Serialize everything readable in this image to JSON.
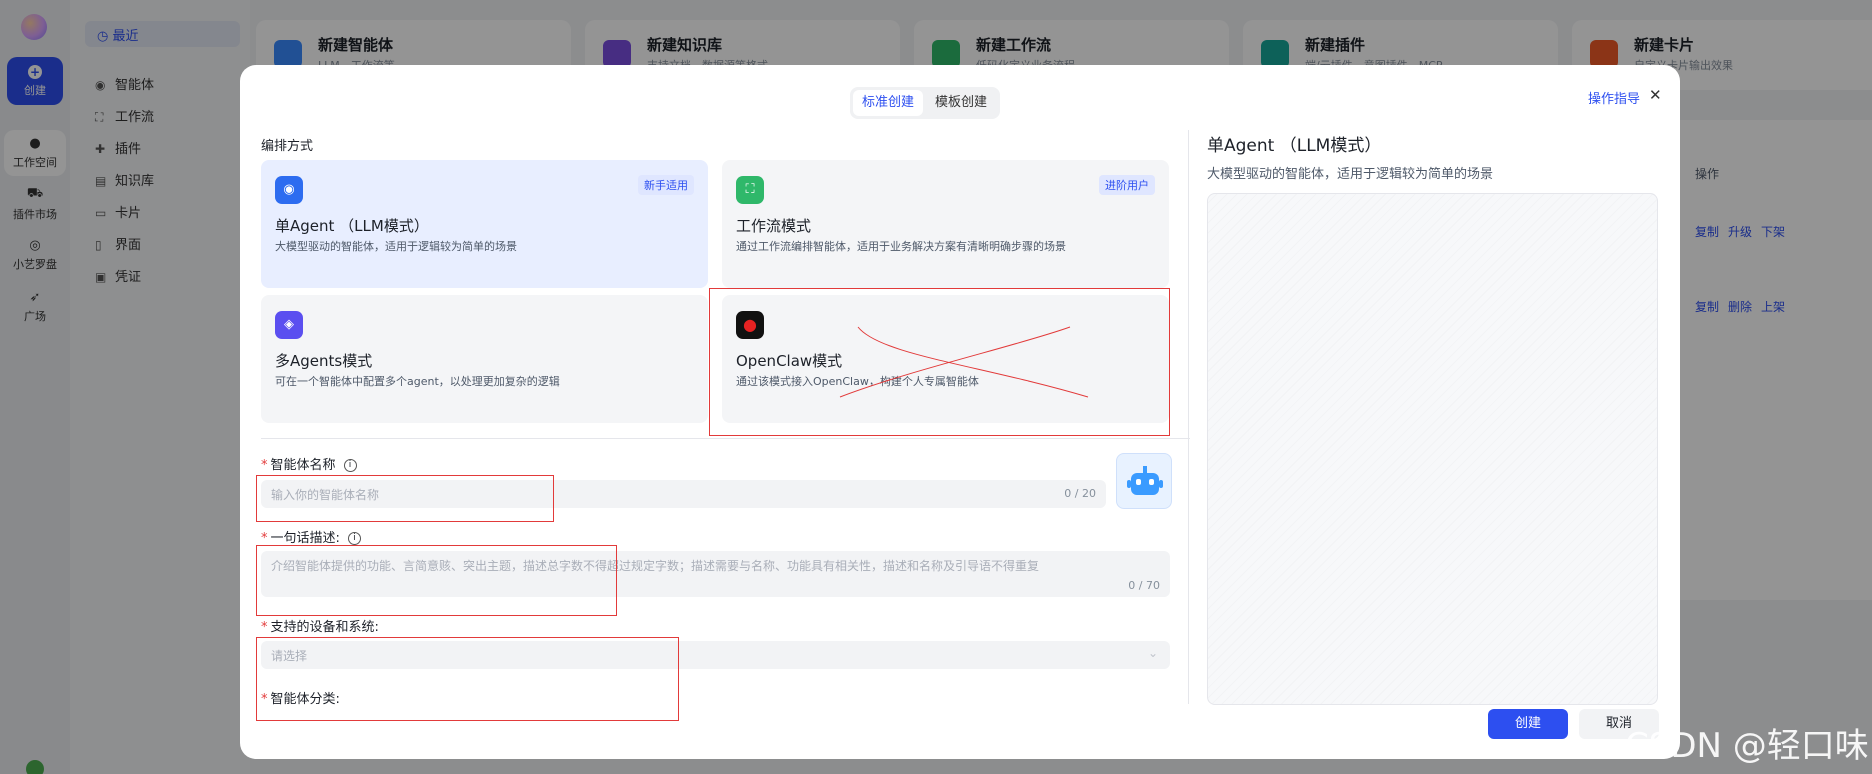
{
  "rail": {
    "create": "创建",
    "items": [
      "工作空间",
      "插件市场",
      "小艺罗盘",
      "广场"
    ]
  },
  "nav": {
    "active": "最近",
    "items": [
      "智能体",
      "工作流",
      "插件",
      "知识库",
      "卡片",
      "界面",
      "凭证"
    ]
  },
  "top_cards": [
    {
      "title": "新建智能体",
      "sub": "LLM、工作流等",
      "color": "#3a8bff"
    },
    {
      "title": "新建知识库",
      "sub": "支持文档、数据源等格式",
      "color": "#7a4fe0"
    },
    {
      "title": "新建工作流",
      "sub": "低码化定义业务流程",
      "color": "#2fb86a"
    },
    {
      "title": "新建插件",
      "sub": "端/云插件、意图插件、MCP",
      "color": "#17a89a"
    },
    {
      "title": "新建卡片",
      "sub": "自定义卡片输出效果",
      "color": "#f05a28"
    }
  ],
  "bg_table": {
    "op_header": "操作",
    "row1": [
      "复制",
      "升级",
      "下架"
    ],
    "row2": [
      "复制",
      "删除",
      "上架"
    ]
  },
  "modal": {
    "tabs": [
      "标准创建",
      "模板创建"
    ],
    "guide": "操作指导",
    "close": "✕",
    "section_title": "编排方式",
    "modes": [
      {
        "title": "单Agent （LLM模式）",
        "desc": "大模型驱动的智能体，适用于逻辑较为简单的场景",
        "tag": "新手适用",
        "color": "#2d6cf0",
        "icon": "robot-icon",
        "selected": true
      },
      {
        "title": "工作流模式",
        "desc": "通过工作流编排智能体，适用于业务解决方案有清晰明确步骤的场景",
        "tag": "进阶用户",
        "color": "#2fb86a",
        "icon": "workflow-icon",
        "selected": false
      },
      {
        "title": "多Agents模式",
        "desc": "可在一个智能体中配置多个agent，以处理更加复杂的逻辑",
        "tag": "",
        "color": "#5b4ff0",
        "icon": "layers-icon",
        "selected": false
      },
      {
        "title": "OpenClaw模式",
        "desc": "通过该模式接入OpenClaw，构建个人专属智能体",
        "tag": "",
        "color": "#111111",
        "icon": "lobster-icon",
        "selected": false
      }
    ],
    "form": {
      "name_label": "智能体名称",
      "name_placeholder": "输入你的智能体名称",
      "name_count": "0 / 20",
      "desc_label": "一句话描述:",
      "desc_placeholder": "介绍智能体提供的功能、言简意赅、突出主题，描述总字数不得超过规定字数；描述需要与名称、功能具有相关性，描述和名称及引导语不得重复",
      "desc_count": "0 / 70",
      "device_label": "支持的设备和系统:",
      "device_placeholder": "请选择",
      "category_label": "智能体分类:"
    },
    "right": {
      "title": "单Agent （LLM模式）",
      "subtitle": "大模型驱动的智能体，适用于逻辑较为简单的场景"
    },
    "buttons": {
      "create": "创建",
      "cancel": "取消"
    }
  },
  "watermark": "CSDN @轻口味"
}
